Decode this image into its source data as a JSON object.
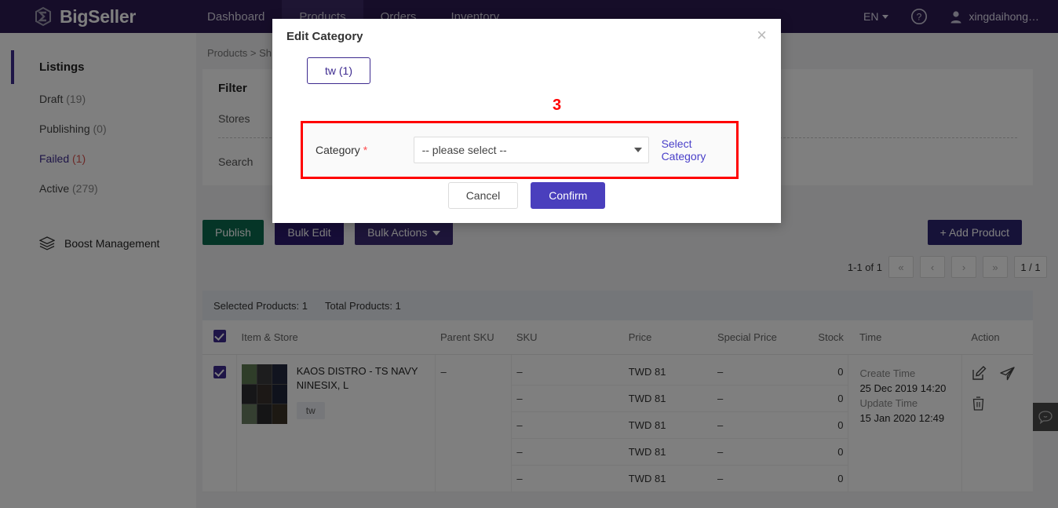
{
  "topnav": {
    "brand": "BigSeller",
    "brand_logo_icon": "bigseller-logo-icon",
    "items": [
      {
        "label": "Dashboard",
        "active": false
      },
      {
        "label": "Products",
        "active": true
      },
      {
        "label": "Orders",
        "active": false
      },
      {
        "label": "Inventory",
        "active": false
      }
    ],
    "language": "EN",
    "help_icon": "question-circle-icon",
    "user_icon": "user-avatar-icon",
    "username": "xingdaihong…"
  },
  "sidebar": {
    "heading": "Listings",
    "items": [
      {
        "label": "Draft",
        "count": "(19)",
        "state": "normal"
      },
      {
        "label": "Publishing",
        "count": "(0)",
        "state": "normal"
      },
      {
        "label": "Failed",
        "count": "(1)",
        "state": "selected"
      },
      {
        "label": "Active",
        "count": "(279)",
        "state": "normal"
      }
    ],
    "boost": {
      "label": "Boost Management",
      "icon": "layers-icon"
    }
  },
  "content": {
    "breadcrumb": "Products > Sh",
    "filter": {
      "title": "Filter",
      "stores_label": "Stores",
      "search_label": "Search"
    },
    "actions": {
      "publish": "Publish",
      "bulk_edit": "Bulk Edit",
      "bulk_actions": "Bulk Actions",
      "add_product": "+  Add Product"
    },
    "pager": {
      "range": "1-1 of 1",
      "first": "«",
      "prev": "‹",
      "next": "›",
      "last": "»",
      "page": "1 / 1"
    },
    "summary": {
      "selected": "Selected Products: 1",
      "total": "Total Products: 1"
    },
    "table": {
      "columns": [
        "Item & Store",
        "Parent SKU",
        "SKU",
        "Price",
        "Special Price",
        "Stock",
        "Time",
        "Action"
      ],
      "product": {
        "name": "KAOS DISTRO - TS NAVY NINESIX, L",
        "store_tag": "tw",
        "parent_sku": "–",
        "thumbnail_icon": "product-thumbnail-collage"
      },
      "variants": [
        {
          "sku": "–",
          "price": "TWD 81",
          "special_price": "–",
          "stock": "0"
        },
        {
          "sku": "–",
          "price": "TWD 81",
          "special_price": "–",
          "stock": "0"
        },
        {
          "sku": "–",
          "price": "TWD 81",
          "special_price": "–",
          "stock": "0"
        },
        {
          "sku": "–",
          "price": "TWD 81",
          "special_price": "–",
          "stock": "0"
        },
        {
          "sku": "–",
          "price": "TWD 81",
          "special_price": "–",
          "stock": "0"
        }
      ],
      "time": {
        "create_label": "Create Time",
        "create_value": "25 Dec 2019 14:20",
        "update_label": "Update Time",
        "update_value": "15 Jan 2020 12:49"
      },
      "action_icons": [
        "edit-icon",
        "send-icon",
        "trash-icon"
      ]
    },
    "chat_icon": "chat-bubble-icon"
  },
  "modal": {
    "title": "Edit Category",
    "close_icon": "close-icon",
    "tab": "tw (1)",
    "annotation": "3",
    "category_label": "Category",
    "required_mark": "*",
    "select_value": "-- please select --",
    "select_link": "Select Category",
    "cancel": "Cancel",
    "confirm": "Confirm"
  },
  "colors": {
    "nav_bg": "#2d1b52",
    "accent_purple": "#3d2a8f",
    "confirm_purple": "#4a3fbd",
    "publish_green": "#0b6b4f",
    "annotation_red": "#ff0000",
    "failed_red": "#d9534f",
    "link_blue": "#4a40c9"
  }
}
